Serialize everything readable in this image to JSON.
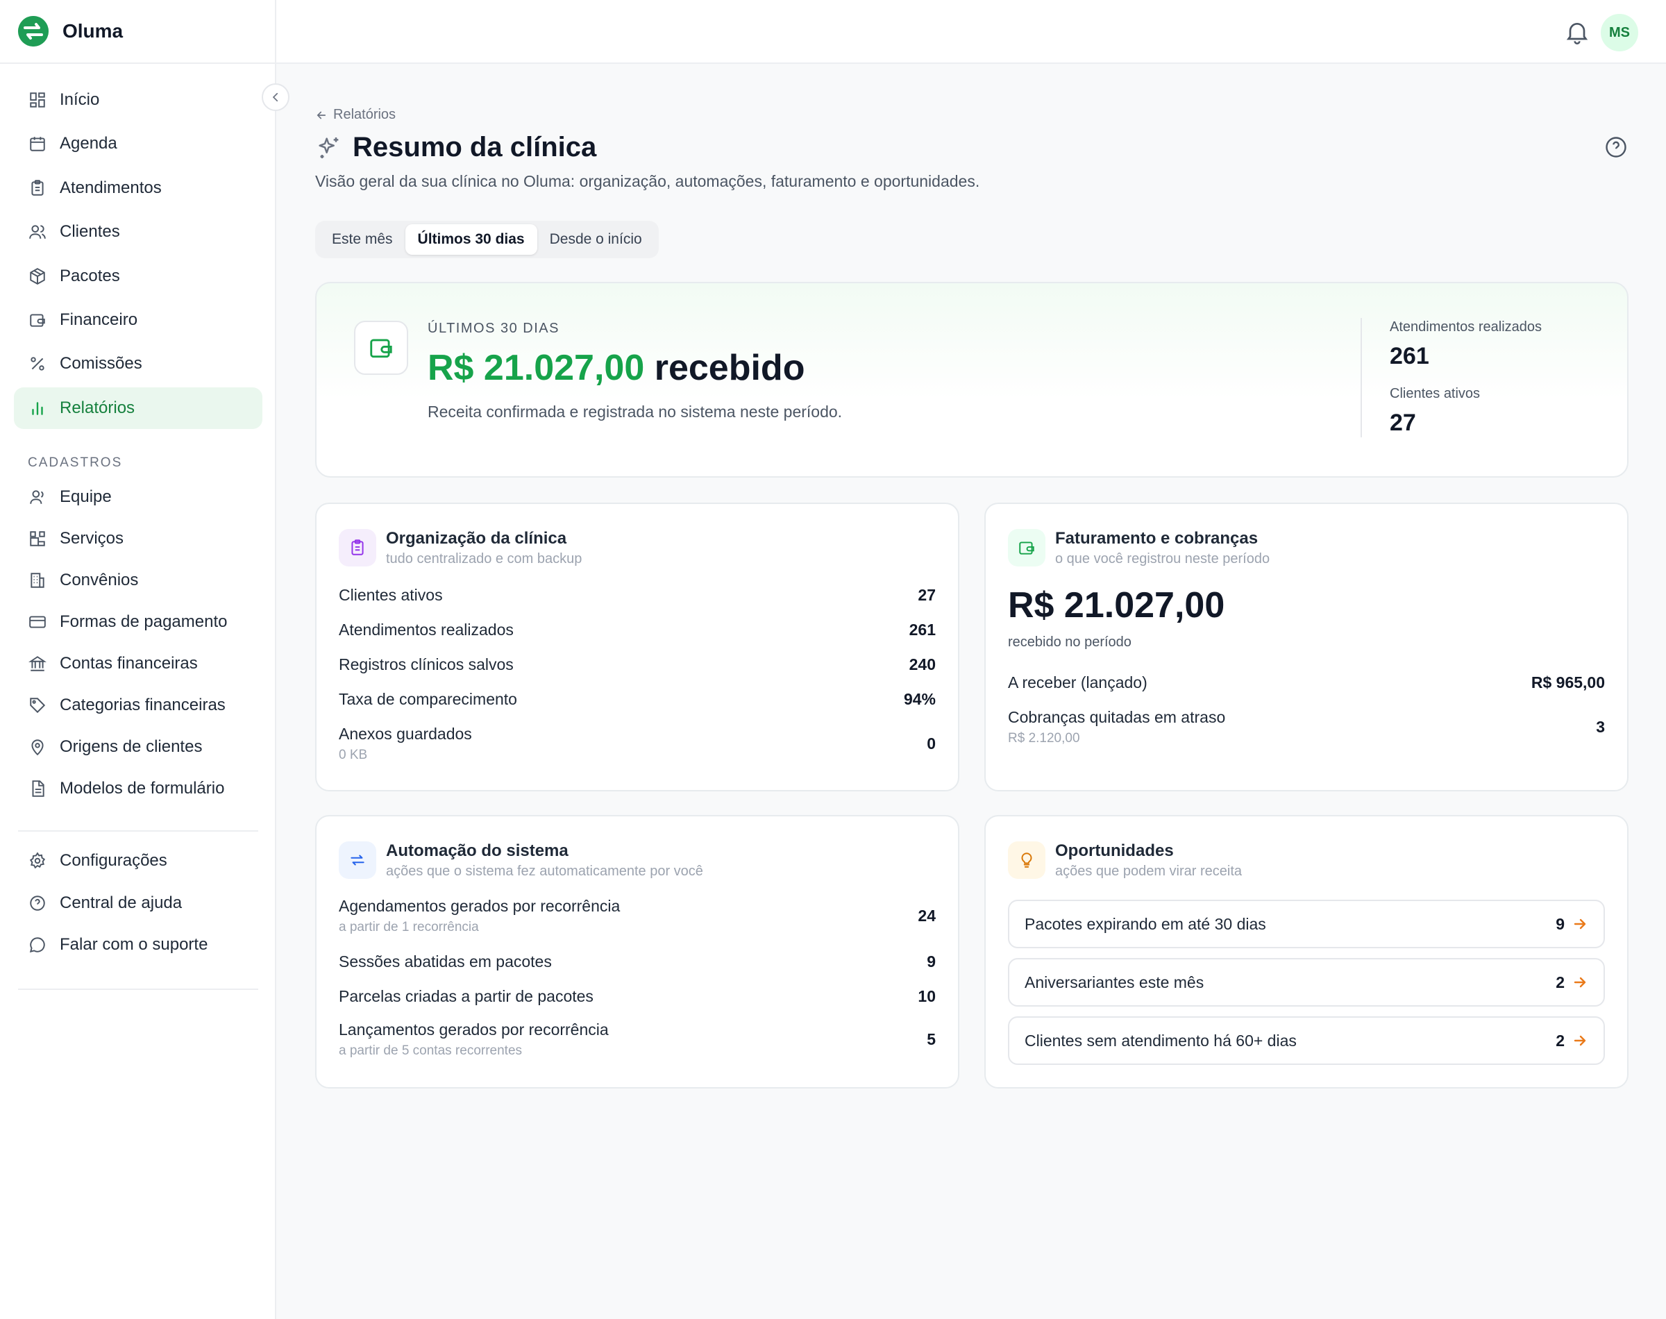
{
  "brand": {
    "name": "Oluma"
  },
  "sidebar": {
    "items": [
      {
        "label": "Início",
        "icon": "grid-icon"
      },
      {
        "label": "Agenda",
        "icon": "calendar-icon"
      },
      {
        "label": "Atendimentos",
        "icon": "clipboard-icon"
      },
      {
        "label": "Clientes",
        "icon": "users-icon"
      },
      {
        "label": "Pacotes",
        "icon": "package-icon"
      },
      {
        "label": "Financeiro",
        "icon": "wallet-icon"
      },
      {
        "label": "Comissões",
        "icon": "percent-icon"
      },
      {
        "label": "Relatórios",
        "icon": "bar-chart-icon",
        "active": true
      }
    ],
    "section_label": "CADASTROS",
    "cadastros": [
      {
        "label": "Equipe",
        "icon": "user-icon"
      },
      {
        "label": "Serviços",
        "icon": "blocks-icon"
      },
      {
        "label": "Convênios",
        "icon": "building-icon"
      },
      {
        "label": "Formas de pagamento",
        "icon": "credit-card-icon"
      },
      {
        "label": "Contas financeiras",
        "icon": "bank-icon"
      },
      {
        "label": "Categorias financeiras",
        "icon": "tag-icon"
      },
      {
        "label": "Origens de clientes",
        "icon": "map-pin-icon"
      },
      {
        "label": "Modelos de formulário",
        "icon": "file-text-icon"
      }
    ],
    "footer": [
      {
        "label": "Configurações",
        "icon": "gear-icon"
      },
      {
        "label": "Central de ajuda",
        "icon": "help-circle-icon"
      },
      {
        "label": "Falar com o suporte",
        "icon": "chat-icon"
      }
    ]
  },
  "header": {
    "avatar_initials": "MS"
  },
  "page": {
    "breadcrumb": "Relatórios",
    "title": "Resumo da clínica",
    "subtitle": "Visão geral da sua clínica no Oluma: organização, automações, faturamento e oportunidades.",
    "tabs": [
      {
        "label": "Este mês",
        "active": false
      },
      {
        "label": "Últimos 30 dias",
        "active": true
      },
      {
        "label": "Desde o início",
        "active": false
      }
    ]
  },
  "hero": {
    "period": "ÚLTIMOS 30 DIAS",
    "amount": "R$ 21.027,00",
    "amount_suffix": "recebido",
    "description": "Receita confirmada e registrada no sistema neste período.",
    "stats": [
      {
        "label": "Atendimentos realizados",
        "value": "261"
      },
      {
        "label": "Clientes ativos",
        "value": "27"
      }
    ]
  },
  "organization": {
    "title": "Organização da clínica",
    "subtitle": "tudo centralizado e com backup",
    "rows": [
      {
        "label": "Clientes ativos",
        "value": "27"
      },
      {
        "label": "Atendimentos realizados",
        "value": "261"
      },
      {
        "label": "Registros clínicos salvos",
        "value": "240"
      },
      {
        "label": "Taxa de comparecimento",
        "value": "94%"
      },
      {
        "label": "Anexos guardados",
        "value": "0",
        "sub": "0 KB"
      }
    ]
  },
  "billing": {
    "title": "Faturamento e cobranças",
    "subtitle": "o que você registrou neste período",
    "amount": "R$ 21.027,00",
    "amount_caption": "recebido no período",
    "rows": [
      {
        "label": "A receber (lançado)",
        "value": "R$ 965,00"
      },
      {
        "label": "Cobranças quitadas em atraso",
        "value": "3",
        "sub": "R$ 2.120,00"
      }
    ]
  },
  "automation": {
    "title": "Automação do sistema",
    "subtitle": "ações que o sistema fez automaticamente por você",
    "rows": [
      {
        "label": "Agendamentos gerados por recorrência",
        "value": "24",
        "sub": "a partir de 1 recorrência"
      },
      {
        "label": "Sessões abatidas em pacotes",
        "value": "9"
      },
      {
        "label": "Parcelas criadas a partir de pacotes",
        "value": "10"
      },
      {
        "label": "Lançamentos gerados por recorrência",
        "value": "5",
        "sub": "a partir de 5 contas recorrentes"
      }
    ]
  },
  "opportunities": {
    "title": "Oportunidades",
    "subtitle": "ações que podem virar receita",
    "items": [
      {
        "label": "Pacotes expirando em até 30 dias",
        "value": "9"
      },
      {
        "label": "Aniversariantes este mês",
        "value": "2"
      },
      {
        "label": "Clientes sem atendimento há 60+ dias",
        "value": "2"
      }
    ]
  },
  "colors": {
    "accent": "#16a34a",
    "accent_bg": "#eaf7ee",
    "opportunity_arrow": "#ea7a1a"
  }
}
